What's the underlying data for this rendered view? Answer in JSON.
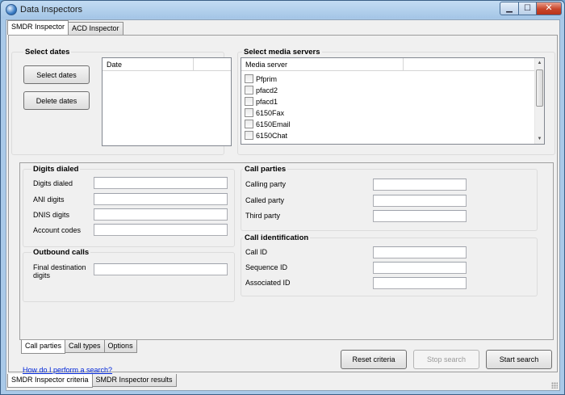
{
  "window": {
    "title": "Data Inspectors",
    "close_glyph": "✕",
    "min_glyph": "▁",
    "max_glyph": "☐"
  },
  "top_tabs": [
    "SMDR Inspector",
    "ACD Inspector"
  ],
  "select_dates": {
    "title": "Select dates",
    "select_btn": "Select dates",
    "delete_btn": "Delete dates",
    "col_date": "Date"
  },
  "media_servers": {
    "title": "Select media servers",
    "col_server": "Media server",
    "items": [
      "Pfprim",
      "pfacd2",
      "pfacd1",
      "6150Fax",
      "6150Email",
      "6150Chat"
    ]
  },
  "digits_dialed": {
    "title": "Digits dialed",
    "fields": [
      "Digits dialed",
      "ANI digits",
      "DNIS digits",
      "Account codes"
    ]
  },
  "outbound_calls": {
    "title": "Outbound calls",
    "line1": "Final destination",
    "line2": "digits"
  },
  "call_parties": {
    "title": "Call parties",
    "fields": [
      "Calling party",
      "Called party",
      "Third party"
    ]
  },
  "call_identification": {
    "title": "Call identification",
    "fields": [
      "Call ID",
      "Sequence ID",
      "Associated ID"
    ]
  },
  "inner_tabs": [
    "Call parties",
    "Call types",
    "Options"
  ],
  "help_link": "How do I perform a search?",
  "actions": {
    "reset": "Reset criteria",
    "stop": "Stop search",
    "start": "Start search"
  },
  "bottom_tabs": [
    "SMDR Inspector criteria",
    "SMDR Inspector results"
  ]
}
